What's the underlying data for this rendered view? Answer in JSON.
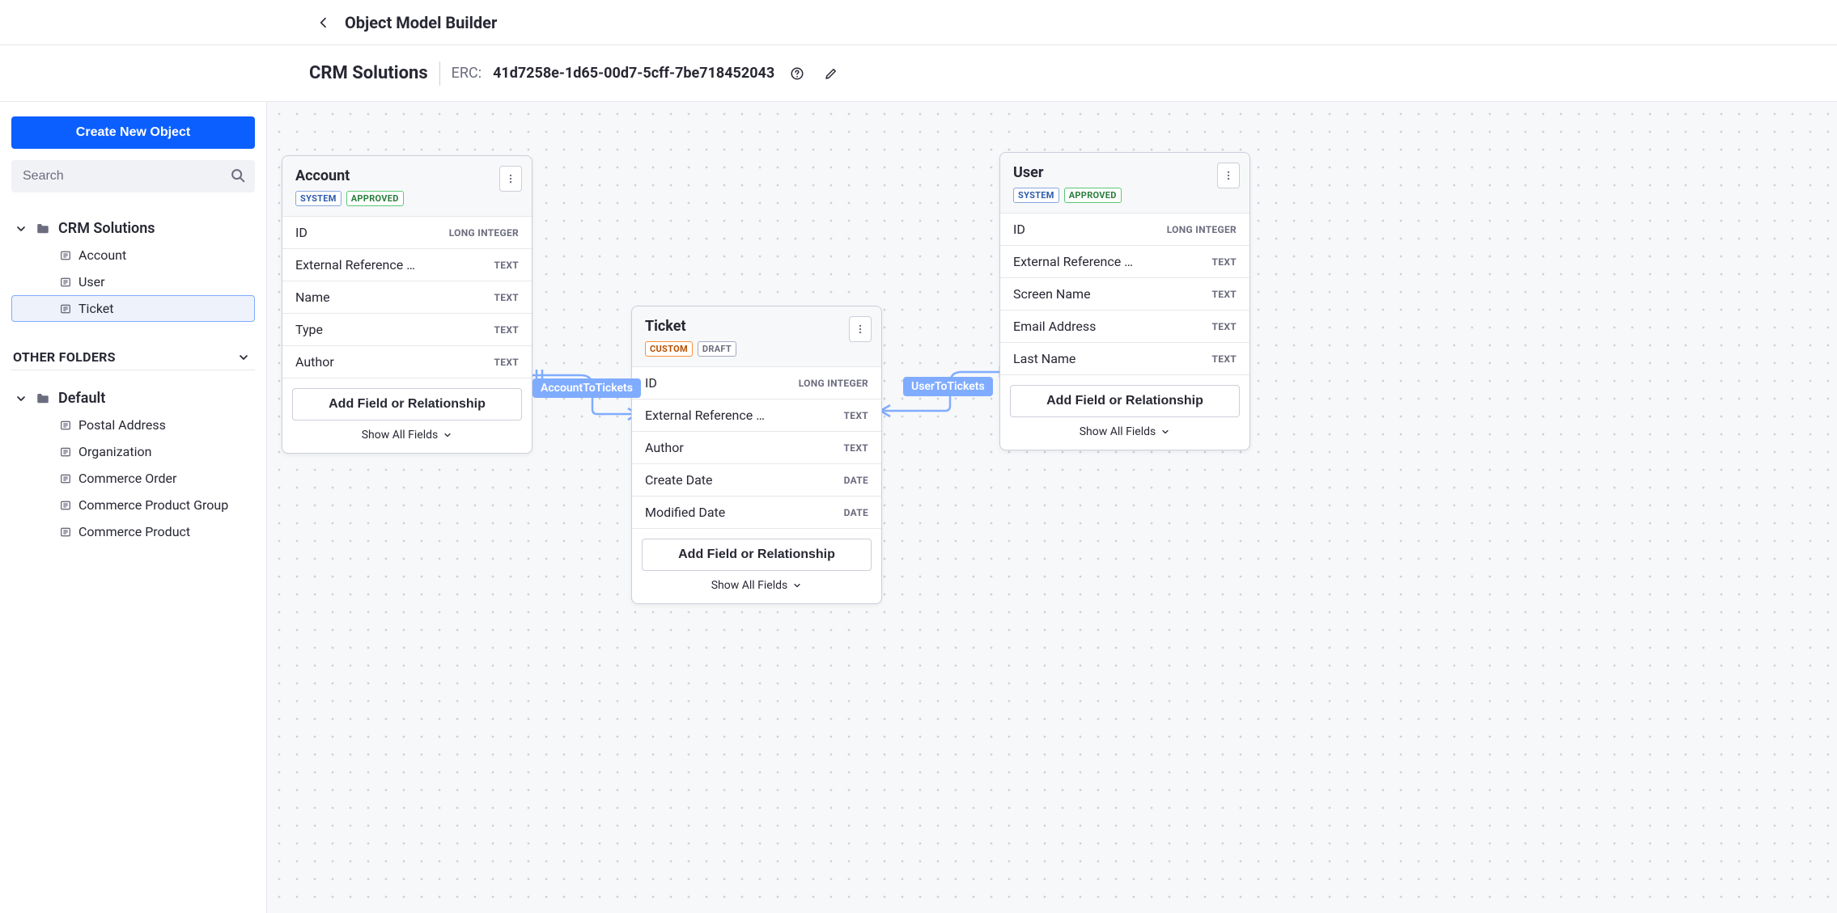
{
  "header": {
    "title": "Object Model Builder"
  },
  "subheader": {
    "project_name": "CRM Solutions",
    "erc_label": "ERC:",
    "erc_value": "41d7258e-1d65-00d7-5cff-7be718452043"
  },
  "sidebar": {
    "create_button": "Create New Object",
    "search_placeholder": "Search",
    "primary_folder": {
      "name": "CRM Solutions",
      "items": [
        {
          "label": "Account",
          "selected": false
        },
        {
          "label": "User",
          "selected": false
        },
        {
          "label": "Ticket",
          "selected": true
        }
      ]
    },
    "other_folders_label": "OTHER FOLDERS",
    "default_folder": {
      "name": "Default",
      "items": [
        {
          "label": "Postal Address"
        },
        {
          "label": "Organization"
        },
        {
          "label": "Commerce Order"
        },
        {
          "label": "Commerce Product Group"
        },
        {
          "label": "Commerce Product"
        }
      ]
    }
  },
  "canvas": {
    "add_field_label": "Add Field or Relationship",
    "show_all_label": "Show All Fields",
    "objects": {
      "account": {
        "title": "Account",
        "badges": [
          "SYSTEM",
          "APPROVED"
        ],
        "fields": [
          {
            "name": "ID",
            "type": "LONG INTEGER"
          },
          {
            "name": "External Reference …",
            "type": "TEXT"
          },
          {
            "name": "Name",
            "type": "TEXT"
          },
          {
            "name": "Type",
            "type": "TEXT"
          },
          {
            "name": "Author",
            "type": "TEXT"
          }
        ]
      },
      "ticket": {
        "title": "Ticket",
        "badges": [
          "CUSTOM",
          "DRAFT"
        ],
        "fields": [
          {
            "name": "ID",
            "type": "LONG INTEGER"
          },
          {
            "name": "External Reference …",
            "type": "TEXT"
          },
          {
            "name": "Author",
            "type": "TEXT"
          },
          {
            "name": "Create Date",
            "type": "DATE"
          },
          {
            "name": "Modified Date",
            "type": "DATE"
          }
        ]
      },
      "user": {
        "title": "User",
        "badges": [
          "SYSTEM",
          "APPROVED"
        ],
        "fields": [
          {
            "name": "ID",
            "type": "LONG INTEGER"
          },
          {
            "name": "External Reference …",
            "type": "TEXT"
          },
          {
            "name": "Screen Name",
            "type": "TEXT"
          },
          {
            "name": "Email Address",
            "type": "TEXT"
          },
          {
            "name": "Last Name",
            "type": "TEXT"
          }
        ]
      }
    },
    "relationships": {
      "account_to_tickets": "AccountToTickets",
      "user_to_tickets": "UserToTickets"
    }
  }
}
